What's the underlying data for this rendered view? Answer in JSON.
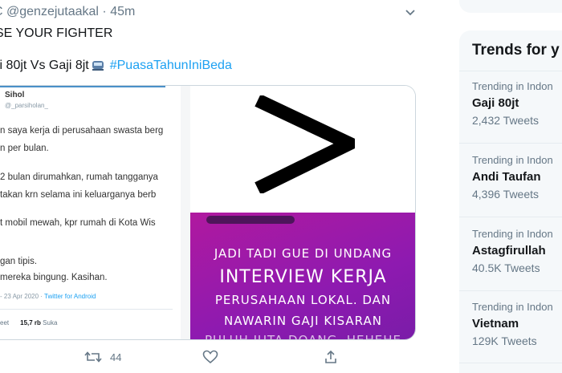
{
  "tweet": {
    "handle": "@genzejutaakal",
    "time": "45m",
    "line1": "SE YOUR FIGHTER",
    "line2_text": "ji 80jt Vs Gaji 8jt",
    "hashtag": "#PuasaTahunIniBeda",
    "actions": {
      "retweet_count": "44"
    }
  },
  "embedded_tweet": {
    "name": "Sihol",
    "handle": "@_parsiholan_",
    "lines": [
      "n saya kerja di perusahaan swasta berg",
      "n per bulan.",
      "2 bulan dirumahkan, rumah tangganya",
      "takan krn selama ini keluarganya berb",
      "t mobil mewah, kpr rumah di Kota Wis",
      "gan tipis.",
      "mereka bingung. Kasihan."
    ],
    "meta_date": "- 23 Apr 2020 · ",
    "meta_source": "Twitter for Android",
    "stats_label": "eet",
    "likes": "15,7 rb",
    "likes_label": "Suka"
  },
  "story_image": {
    "symbol": ">",
    "lines": [
      "JADI TADI GUE DI UNDANG",
      "INTERVIEW KERJA",
      "PERUSAHAAN LOKAL. DAN",
      "NAWARIN GAJI KISARAN",
      "PULUH JUTA DOANG. HEHEHE"
    ]
  },
  "trends": {
    "title": "Trends for y",
    "items": [
      {
        "context": "Trending in Indon",
        "name": "Gaji 80jt",
        "count": "2,432 Tweets"
      },
      {
        "context": "Trending in Indon",
        "name": "Andi Taufan",
        "count": "4,396 Tweets"
      },
      {
        "context": "Trending in Indon",
        "name": "Astagfirullah",
        "count": "40.5K Tweets"
      },
      {
        "context": "Trending in Indon",
        "name": "Vietnam",
        "count": "129K Tweets"
      }
    ]
  },
  "colors": {
    "link": "#1da1f2",
    "secondary_text": "#657786",
    "panel_bg": "#f5f8fa",
    "purple": "#9b1aad"
  }
}
